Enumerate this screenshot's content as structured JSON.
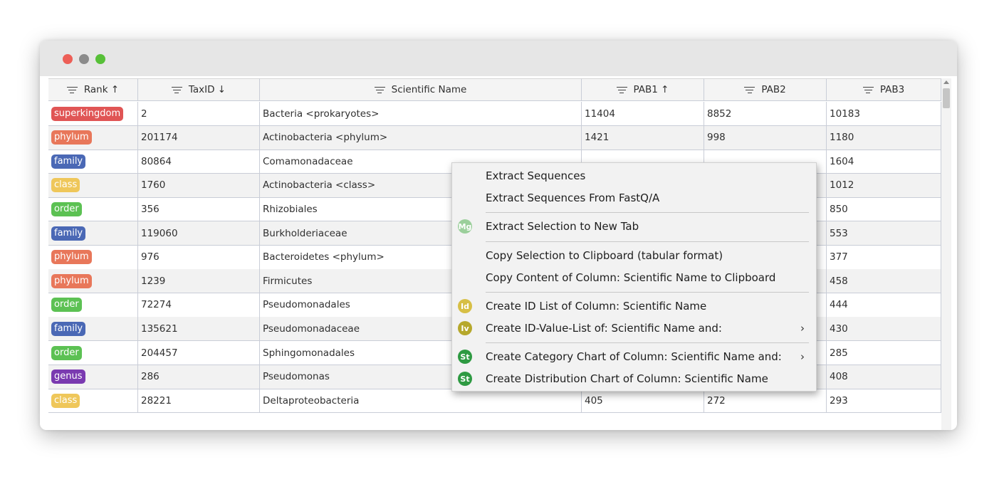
{
  "table": {
    "columns": [
      {
        "label": "Rank ↑"
      },
      {
        "label": "TaxID ↓"
      },
      {
        "label": "Scientific Name"
      },
      {
        "label": "PAB1 ↑"
      },
      {
        "label": "PAB2"
      },
      {
        "label": "PAB3"
      }
    ],
    "rows": [
      {
        "rank": "superkingdom",
        "rank_color": "#e05555",
        "taxid": "2",
        "name": "Bacteria <prokaryotes>",
        "pab1": "11404",
        "pab2": "8852",
        "pab3": "10183"
      },
      {
        "rank": "phylum",
        "rank_color": "#e8775a",
        "taxid": "201174",
        "name": "Actinobacteria <phylum>",
        "pab1": "1421",
        "pab2": "998",
        "pab3": "1180"
      },
      {
        "rank": "family",
        "rank_color": "#4a68b5",
        "taxid": "80864",
        "name": "Comamonadaceae",
        "pab1": "",
        "pab2": "",
        "pab3": "1604"
      },
      {
        "rank": "class",
        "rank_color": "#efc75a",
        "taxid": "1760",
        "name": "Actinobacteria <class>",
        "pab1": "",
        "pab2": "",
        "pab3": "1012"
      },
      {
        "rank": "order",
        "rank_color": "#5cc153",
        "taxid": "356",
        "name": "Rhizobiales",
        "pab1": "",
        "pab2": "",
        "pab3": "850"
      },
      {
        "rank": "family",
        "rank_color": "#4a68b5",
        "taxid": "119060",
        "name": "Burkholderiaceae",
        "pab1": "",
        "pab2": "",
        "pab3": "553"
      },
      {
        "rank": "phylum",
        "rank_color": "#e8775a",
        "taxid": "976",
        "name": "Bacteroidetes <phylum>",
        "pab1": "",
        "pab2": "",
        "pab3": "377"
      },
      {
        "rank": "phylum",
        "rank_color": "#e8775a",
        "taxid": "1239",
        "name": "Firmicutes",
        "pab1": "",
        "pab2": "",
        "pab3": "458"
      },
      {
        "rank": "order",
        "rank_color": "#5cc153",
        "taxid": "72274",
        "name": "Pseudomonadales",
        "pab1": "",
        "pab2": "",
        "pab3": "444"
      },
      {
        "rank": "family",
        "rank_color": "#4a68b5",
        "taxid": "135621",
        "name": "Pseudomonadaceae",
        "pab1": "",
        "pab2": "",
        "pab3": "430"
      },
      {
        "rank": "order",
        "rank_color": "#5cc153",
        "taxid": "204457",
        "name": "Sphingomonadales",
        "pab1": "",
        "pab2": "",
        "pab3": "285"
      },
      {
        "rank": "genus",
        "rank_color": "#7a3ab0",
        "taxid": "286",
        "name": "Pseudomonas",
        "pab1": "",
        "pab2": "",
        "pab3": "408"
      },
      {
        "rank": "class",
        "rank_color": "#efc75a",
        "taxid": "28221",
        "name": "Deltaproteobacteria",
        "pab1": "405",
        "pab2": "272",
        "pab3": "293"
      }
    ]
  },
  "context_menu": {
    "items": [
      {
        "label": "Extract Sequences",
        "icon": "",
        "icon_color": "",
        "submenu": false
      },
      {
        "label": "Extract Sequences From FastQ/A",
        "icon": "",
        "icon_color": "",
        "submenu": false
      },
      {
        "label": "Extract Selection to New Tab",
        "icon": "Mg",
        "icon_color": "#9bcf9b",
        "submenu": false
      },
      {
        "label": "Copy Selection to Clipboard (tabular format)",
        "icon": "",
        "icon_color": "",
        "submenu": false
      },
      {
        "label": "Copy Content of Column: Scientific Name to Clipboard",
        "icon": "",
        "icon_color": "",
        "submenu": false
      },
      {
        "label": "Create ID List of Column: Scientific Name",
        "icon": "Id",
        "icon_color": "#d7bf45",
        "submenu": false
      },
      {
        "label": "Create ID-Value-List of: Scientific Name and:",
        "icon": "Iv",
        "icon_color": "#b6a82c",
        "submenu": true
      },
      {
        "label": "Create Category Chart of Column: Scientific Name and:",
        "icon": "St",
        "icon_color": "#2e9a42",
        "submenu": true
      },
      {
        "label": "Create Distribution Chart of Column: Scientific Name",
        "icon": "St",
        "icon_color": "#2e9a42",
        "submenu": false
      }
    ],
    "submenu_arrow": "›"
  }
}
